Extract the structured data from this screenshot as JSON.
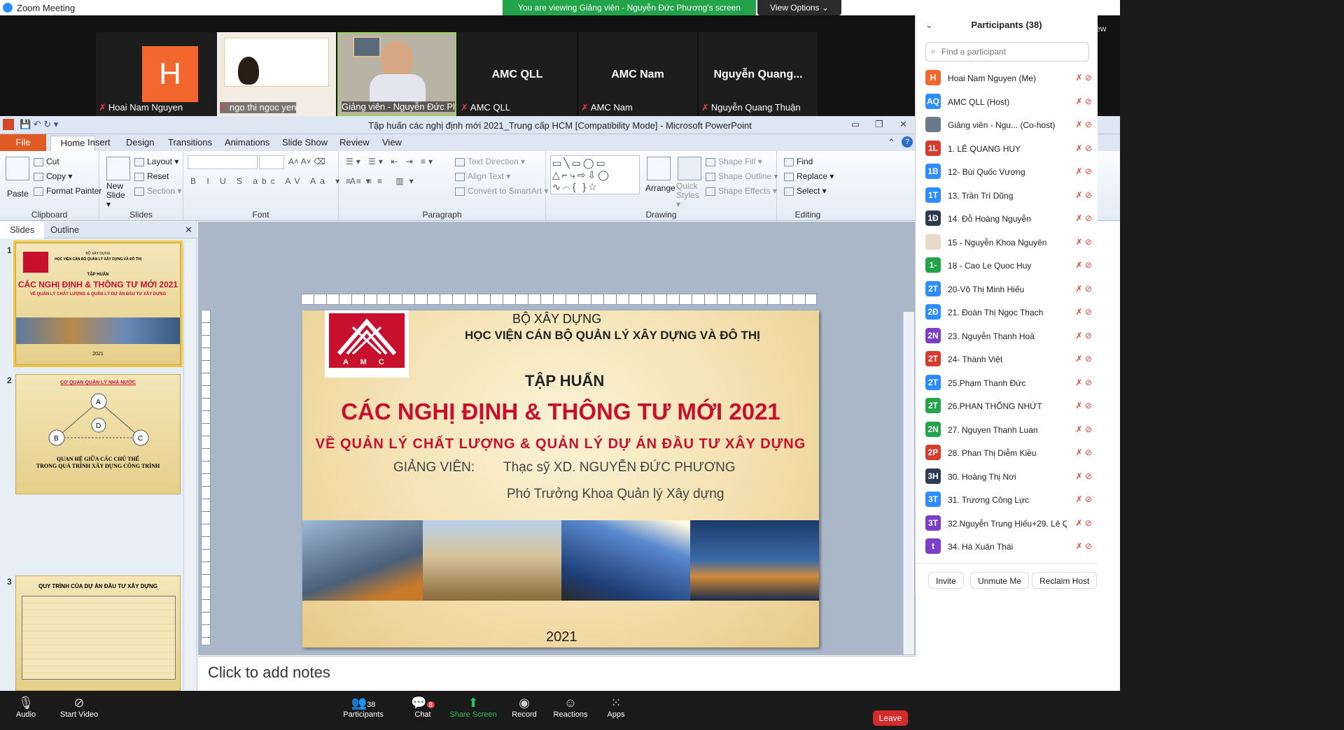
{
  "app": {
    "title": "Zoom Meeting"
  },
  "banner": {
    "viewing": "You are viewing Giảng viên - Nguyễn Đức Phương's screen",
    "view_options": "View Options ⌄"
  },
  "strip": {
    "view_label": "View",
    "tiles": [
      {
        "label": "Hoai Nam Nguyen",
        "avatar": "H"
      },
      {
        "label": "ngo thi ngoc yen"
      },
      {
        "label": "Giảng viên - Nguyễn Đức Phương"
      },
      {
        "label": "AMC QLL",
        "big": "AMC QLL"
      },
      {
        "label": "AMC Nam",
        "big": "AMC Nam"
      },
      {
        "label": "Nguyễn Quang Thuận",
        "big": "Nguyễn  Quang..."
      }
    ]
  },
  "ppt": {
    "window_title": "Tập huấn các nghị định mới 2021_Trung cấp HCM [Compatibility Mode]  -  Microsoft PowerPoint",
    "tabs": [
      "File",
      "Home",
      "Insert",
      "Design",
      "Transitions",
      "Animations",
      "Slide Show",
      "Review",
      "View"
    ],
    "ribbon": {
      "clipboard": {
        "paste": "Paste",
        "cut": "Cut",
        "copy": "Copy ▾",
        "format_painter": "Format Painter",
        "label": "Clipboard"
      },
      "slides": {
        "new_slide": "New Slide ▾",
        "layout": "Layout ▾",
        "reset": "Reset",
        "section": "Section ▾",
        "label": "Slides"
      },
      "font": {
        "label": "Font"
      },
      "paragraph": {
        "text_direction": "Text Direction ▾",
        "align_text": "Align Text ▾",
        "convert": "Convert to SmartArt ▾",
        "label": "Paragraph"
      },
      "drawing": {
        "arrange": "Arrange",
        "quick_styles": "Quick Styles ▾",
        "shape_fill": "Shape Fill ▾",
        "shape_outline": "Shape Outline ▾",
        "shape_effects": "Shape Effects ▾",
        "label": "Drawing"
      },
      "editing": {
        "find": "Find",
        "replace": "Replace ▾",
        "select": "Select ▾",
        "label": "Editing"
      }
    },
    "pane_tabs": {
      "slides": "Slides",
      "outline": "Outline"
    },
    "thumbs": [
      {
        "num": "1",
        "t1": "BỘ XÂY DỰNG",
        "t2": "HỌC VIỆN CÁN BỘ QUẢN LÝ XÂY DỰNG VÀ ĐÔ THỊ",
        "t3": "TẬP HUẤN",
        "t4": "CÁC NGHỊ ĐỊNH & THÔNG TƯ MỚI 2021",
        "t5": "VỀ QUẢN LÝ CHẤT LƯỢNG & QUẢN LÝ DỰ ÁN ĐẦU TƯ XÂY DỰNG",
        "year": "2021"
      },
      {
        "num": "2",
        "t1": "CƠ QUAN QUẢN LÝ NHÀ NƯỚC",
        "a": "A",
        "b": "B",
        "c": "C",
        "d": "D",
        "t2": "QUAN HỆ GIỮA CÁC CHỦ THỂ",
        "t3": "TRONG QUÁ TRÌNH XÂY DỰNG CÔNG TRÌNH"
      },
      {
        "num": "3",
        "t1": "QUY TRÌNH CỦA DỰ ÁN ĐẦU TƯ XÂY DỰNG"
      }
    ],
    "slide": {
      "ministry": "BỘ XÂY DỰNG",
      "academy": "HỌC VIỆN CÁN BỘ QUẢN LÝ XÂY DỰNG VÀ ĐÔ THỊ",
      "training": "TẬP HUẤN",
      "headline": "CÁC NGHỊ ĐỊNH & THÔNG TƯ MỚI 2021",
      "subheadline": "VỀ QUẢN LÝ CHẤT LƯỢNG & QUẢN LÝ DỰ ÁN ĐẦU TƯ XÂY DỰNG",
      "lecturer_label": "GIẢNG VIÊN:",
      "lecturer": "Thạc sỹ XD. NGUYỄN ĐỨC PHƯƠNG",
      "role": "Phó Trưởng Khoa Quản lý Xây dựng",
      "year": "2021",
      "logo_text": "A M C"
    },
    "notes": "Click to add notes"
  },
  "participants": {
    "header": "Participants (38)",
    "search_placeholder": "Find a participant",
    "rows": [
      {
        "initials": "H",
        "color": "#f3662d",
        "name": "Hoai Nam Nguyen (Me)"
      },
      {
        "initials": "AQ",
        "color": "#2d8cff",
        "name": "AMC QLL (Host)"
      },
      {
        "initials": "",
        "color": "#6b7a8a",
        "name": "Giảng viên - Ngu...  (Co-host)"
      },
      {
        "initials": "1L",
        "color": "#d63b2f",
        "name": "1. LÊ QUANG HUY"
      },
      {
        "initials": "1B",
        "color": "#2d8cff",
        "name": "12- Bùi Quốc Vương"
      },
      {
        "initials": "1T",
        "color": "#2d8cff",
        "name": "13. Trần Trí Dũng"
      },
      {
        "initials": "1Đ",
        "color": "#2e3a4f",
        "name": "14. Đỗ Hoàng Nguyễn"
      },
      {
        "initials": "",
        "color": "#e9d8c8",
        "name": "15 - Nguyễn Khoa Nguyên"
      },
      {
        "initials": "1-",
        "color": "#23a44a",
        "name": "18 - Cao Le Quoc Huy"
      },
      {
        "initials": "2T",
        "color": "#2d8cff",
        "name": "20-Võ Thị Minh Hiếu"
      },
      {
        "initials": "2Đ",
        "color": "#2d8cff",
        "name": "21. Đoàn Thị Ngọc Thạch"
      },
      {
        "initials": "2N",
        "color": "#7b3fc9",
        "name": "23. Nguyễn Thanh Hoà"
      },
      {
        "initials": "2T",
        "color": "#d63b2f",
        "name": "24-  Thành Việt"
      },
      {
        "initials": "2T",
        "color": "#2d8cff",
        "name": "25.Phạm Thanh Đức"
      },
      {
        "initials": "2T",
        "color": "#23a44a",
        "name": "26.PHAN THỐNG NHỨT"
      },
      {
        "initials": "2N",
        "color": "#23a44a",
        "name": "27. Nguyen Thanh Luan"
      },
      {
        "initials": "2P",
        "color": "#d63b2f",
        "name": "28. Phan Thị Diễm Kiều"
      },
      {
        "initials": "3H",
        "color": "#2e3a4f",
        "name": "30. Hoàng Thị Nơi"
      },
      {
        "initials": "3T",
        "color": "#2d8cff",
        "name": "31. Trương Công Lực"
      },
      {
        "initials": "3T",
        "color": "#7b3fc9",
        "name": "32.Nguyễn Trung Hiếu+29. Lê Q..."
      },
      {
        "initials": "t",
        "color": "#7b3fc9",
        "name": "34. Hà Xuân Thái"
      }
    ],
    "invite": "Invite",
    "unmute_me": "Unmute Me",
    "reclaim_host": "Reclaim Host"
  },
  "toolbar": {
    "audio": "Audio",
    "start_video": "Start Video",
    "participants": "Participants",
    "participants_count": "38",
    "chat": "Chat",
    "chat_badge": "8",
    "share_screen": "Share Screen",
    "record": "Record",
    "reactions": "Reactions",
    "apps": "Apps",
    "leave": "Leave"
  }
}
